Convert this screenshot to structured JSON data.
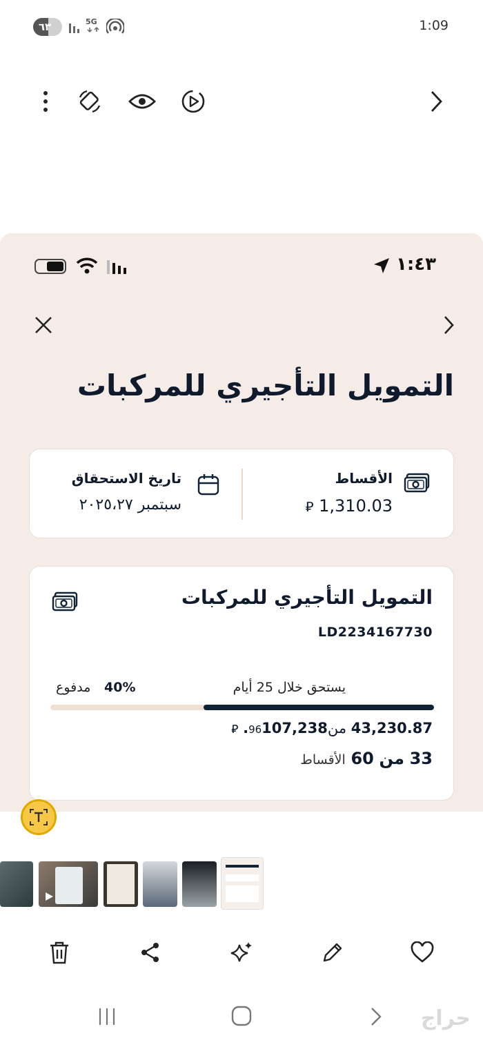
{
  "outer_status": {
    "time": "1:09",
    "battery": "٦٣",
    "network": "5G"
  },
  "inner_status": {
    "time": "١:٤٣"
  },
  "page": {
    "title": "التمويل التأجيري للمركبات"
  },
  "summary_card": {
    "installments_label": "الأقساط",
    "installments_value": "1,310.03",
    "due_date_label": "تاريخ الاستحقاق",
    "due_date_value": "سبتمبر ٢٠٢٥،٢٧"
  },
  "detail_card": {
    "title": "التمويل التأجيري للمركبات",
    "reference": "LD2234167730",
    "due_text": "يستحق خلال 25 أيام",
    "paid_percent_text": "40%",
    "paid_label": "مدفوع",
    "progress_percent": 40,
    "paid_amount": "43,230.87",
    "of_label": "من",
    "total_amount_int": "107,238.",
    "total_amount_dec": "96",
    "installments_paid": "33",
    "installments_of": "من",
    "installments_total": "60",
    "installments_label": "الأقساط"
  },
  "currency_symbol": "⃁",
  "watermark": "حراج",
  "icons": {
    "more": "more-vertical-icon",
    "rotate": "rotate-icon",
    "eye": "eye-icon",
    "motion": "motion-photo-icon",
    "forward": "chevron-right-icon",
    "money": "banknote-icon",
    "calendar": "calendar-icon",
    "delete": "trash-icon",
    "share": "share-icon",
    "ai": "sparkle-icon",
    "edit": "pencil-icon",
    "favorite": "heart-icon"
  },
  "colors": {
    "brand_dark": "#102236",
    "bg_pink": "#f5ece8",
    "progress_track": "#ede0d6"
  }
}
